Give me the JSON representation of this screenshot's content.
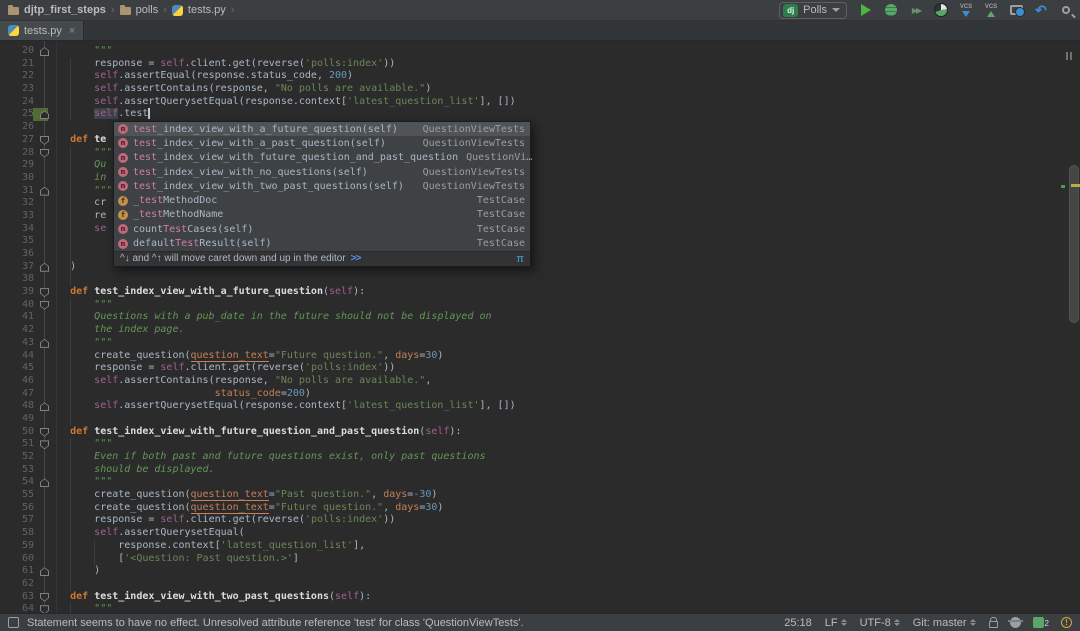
{
  "colors": {
    "editor_bg": "#2b2b2b",
    "bar_bg": "#3c3f41",
    "keyword": "#cc7832",
    "string": "#6a8759",
    "docstring": "#629755",
    "number": "#6897bb",
    "self": "#9e6191",
    "kwarg": "#c57f5a",
    "line_number": "#606366",
    "match": "#cd7fa7",
    "warn_stripe": "#b8ae3f",
    "vcs_added": "#526b34"
  },
  "breadcrumbs": {
    "project": "djtp_first_steps",
    "folder": "polls",
    "file": "tests.py",
    "separator": "›"
  },
  "toolbar": {
    "run_config": {
      "badge": "dj",
      "label": "Polls"
    },
    "icons": [
      {
        "name": "run-icon"
      },
      {
        "name": "debug-icon"
      },
      {
        "name": "coverage-icon",
        "glyph": "▶▶"
      },
      {
        "name": "concurrency-diagram-icon"
      },
      {
        "name": "vcs-update-icon",
        "text": "VCS"
      },
      {
        "name": "vcs-commit-icon",
        "text": "VCS"
      },
      {
        "name": "local-history-icon"
      },
      {
        "name": "rollback-icon",
        "glyph": "↶"
      },
      {
        "name": "search-everywhere-icon"
      }
    ]
  },
  "tab": {
    "title": "tests.py",
    "close_label": "×"
  },
  "editor": {
    "lines": [
      {
        "n": 20,
        "i": 8,
        "fold": "up",
        "segs": [
          [
            "d",
            "\"\"\""
          ]
        ]
      },
      {
        "n": 21,
        "i": 8,
        "segs": [
          [
            "p",
            "response = "
          ],
          [
            "sf",
            "self"
          ],
          [
            "p",
            ".client.get(reverse("
          ],
          [
            "s",
            "'polls:index'"
          ],
          [
            "p",
            "))"
          ]
        ]
      },
      {
        "n": 22,
        "i": 8,
        "segs": [
          [
            "sf",
            "self"
          ],
          [
            "p",
            ".assertEqual(response.status_code, "
          ],
          [
            "n",
            "200"
          ],
          [
            "p",
            ")"
          ]
        ]
      },
      {
        "n": 23,
        "i": 8,
        "segs": [
          [
            "sf",
            "self"
          ],
          [
            "p",
            ".assertContains(response, "
          ],
          [
            "s",
            "\"No polls are available.\""
          ],
          [
            "p",
            ")"
          ]
        ]
      },
      {
        "n": 24,
        "i": 8,
        "segs": [
          [
            "sf",
            "self"
          ],
          [
            "p",
            ".assertQuerysetEqual(response.context["
          ],
          [
            "s",
            "'latest_question_list'"
          ],
          [
            "p",
            "], [])"
          ]
        ]
      },
      {
        "n": 25,
        "i": 8,
        "fold": "up",
        "vcs": true,
        "caret": true,
        "segs": [
          [
            "hl-sf",
            "self"
          ],
          [
            "p",
            ".test"
          ]
        ]
      },
      {
        "n": 26,
        "i": 0,
        "segs": []
      },
      {
        "n": 27,
        "i": 4,
        "fold": "down",
        "segs": [
          [
            "k",
            "def "
          ],
          [
            "fn",
            "te"
          ]
        ]
      },
      {
        "n": 28,
        "i": 8,
        "fold": "down",
        "segs": [
          [
            "d",
            "\"\"\""
          ]
        ]
      },
      {
        "n": 29,
        "i": 8,
        "segs": [
          [
            "di",
            "Qu"
          ]
        ]
      },
      {
        "n": 30,
        "i": 8,
        "segs": [
          [
            "di",
            "in"
          ]
        ]
      },
      {
        "n": 31,
        "i": 8,
        "fold": "up",
        "segs": [
          [
            "d",
            "\"\"\""
          ]
        ]
      },
      {
        "n": 32,
        "i": 8,
        "segs": [
          [
            "p",
            "cr"
          ]
        ]
      },
      {
        "n": 33,
        "i": 8,
        "segs": [
          [
            "p",
            "re"
          ]
        ]
      },
      {
        "n": 34,
        "i": 8,
        "segs": [
          [
            "sf",
            "se"
          ]
        ]
      },
      {
        "n": 35,
        "i": 0,
        "segs": []
      },
      {
        "n": 36,
        "i": 0,
        "segs": []
      },
      {
        "n": 37,
        "i": 4,
        "fold": "up",
        "segs": [
          [
            "p",
            ")"
          ]
        ]
      },
      {
        "n": 38,
        "i": 0,
        "segs": []
      },
      {
        "n": 39,
        "i": 4,
        "fold": "down",
        "segs": [
          [
            "k",
            "def "
          ],
          [
            "fn",
            "test_index_view_with_a_future_question"
          ],
          [
            "p",
            "("
          ],
          [
            "sf",
            "self"
          ],
          [
            "p",
            "):"
          ]
        ]
      },
      {
        "n": 40,
        "i": 8,
        "fold": "down",
        "segs": [
          [
            "d",
            "\"\"\""
          ]
        ]
      },
      {
        "n": 41,
        "i": 8,
        "segs": [
          [
            "di",
            "Questions with a pub_date in the future should not be displayed on"
          ]
        ]
      },
      {
        "n": 42,
        "i": 8,
        "segs": [
          [
            "di",
            "the index page."
          ]
        ]
      },
      {
        "n": 43,
        "i": 8,
        "fold": "up",
        "segs": [
          [
            "d",
            "\"\"\""
          ]
        ]
      },
      {
        "n": 44,
        "i": 8,
        "segs": [
          [
            "p",
            "create_question("
          ],
          [
            "kwu",
            "question_text"
          ],
          [
            "p",
            "="
          ],
          [
            "s",
            "\"Future question.\""
          ],
          [
            "p",
            ", "
          ],
          [
            "kw",
            "days"
          ],
          [
            "p",
            "="
          ],
          [
            "n",
            "30"
          ],
          [
            "p",
            ")"
          ]
        ]
      },
      {
        "n": 45,
        "i": 8,
        "segs": [
          [
            "p",
            "response = "
          ],
          [
            "sf",
            "self"
          ],
          [
            "p",
            ".client.get(reverse("
          ],
          [
            "s",
            "'polls:index'"
          ],
          [
            "p",
            "))"
          ]
        ]
      },
      {
        "n": 46,
        "i": 8,
        "segs": [
          [
            "sf",
            "self"
          ],
          [
            "p",
            ".assertContains(response, "
          ],
          [
            "s",
            "\"No polls are available.\""
          ],
          [
            "p",
            ","
          ]
        ]
      },
      {
        "n": 47,
        "i": 28,
        "segs": [
          [
            "kw",
            "status_code"
          ],
          [
            "p",
            "="
          ],
          [
            "n",
            "200"
          ],
          [
            "p",
            ")"
          ]
        ]
      },
      {
        "n": 48,
        "i": 8,
        "fold": "up",
        "segs": [
          [
            "sf",
            "self"
          ],
          [
            "p",
            ".assertQuerysetEqual(response.context["
          ],
          [
            "s",
            "'latest_question_list'"
          ],
          [
            "p",
            "], [])"
          ]
        ]
      },
      {
        "n": 49,
        "i": 0,
        "segs": []
      },
      {
        "n": 50,
        "i": 4,
        "fold": "down",
        "segs": [
          [
            "k",
            "def "
          ],
          [
            "fn",
            "test_index_view_with_future_question_and_past_question"
          ],
          [
            "p",
            "("
          ],
          [
            "sf",
            "self"
          ],
          [
            "p",
            "):"
          ]
        ]
      },
      {
        "n": 51,
        "i": 8,
        "fold": "down",
        "segs": [
          [
            "d",
            "\"\"\""
          ]
        ]
      },
      {
        "n": 52,
        "i": 8,
        "segs": [
          [
            "di",
            "Even if both past and future questions exist, only past questions"
          ]
        ]
      },
      {
        "n": 53,
        "i": 8,
        "segs": [
          [
            "di",
            "should be displayed."
          ]
        ]
      },
      {
        "n": 54,
        "i": 8,
        "fold": "up",
        "segs": [
          [
            "d",
            "\"\"\""
          ]
        ]
      },
      {
        "n": 55,
        "i": 8,
        "segs": [
          [
            "p",
            "create_question("
          ],
          [
            "kwu",
            "question_text"
          ],
          [
            "p",
            "="
          ],
          [
            "s",
            "\"Past question.\""
          ],
          [
            "p",
            ", "
          ],
          [
            "kw",
            "days"
          ],
          [
            "p",
            "="
          ],
          [
            "n",
            "-30"
          ],
          [
            "p",
            ")"
          ]
        ]
      },
      {
        "n": 56,
        "i": 8,
        "segs": [
          [
            "p",
            "create_question("
          ],
          [
            "kwu",
            "question_text"
          ],
          [
            "p",
            "="
          ],
          [
            "s",
            "\"Future question.\""
          ],
          [
            "p",
            ", "
          ],
          [
            "kw",
            "days"
          ],
          [
            "p",
            "="
          ],
          [
            "n",
            "30"
          ],
          [
            "p",
            ")"
          ]
        ]
      },
      {
        "n": 57,
        "i": 8,
        "segs": [
          [
            "p",
            "response = "
          ],
          [
            "sf",
            "self"
          ],
          [
            "p",
            ".client.get(reverse("
          ],
          [
            "s",
            "'polls:index'"
          ],
          [
            "p",
            "))"
          ]
        ]
      },
      {
        "n": 58,
        "i": 8,
        "segs": [
          [
            "sf",
            "self"
          ],
          [
            "p",
            ".assertQuerysetEqual("
          ]
        ]
      },
      {
        "n": 59,
        "i": 12,
        "segs": [
          [
            "p",
            "response.context["
          ],
          [
            "s",
            "'latest_question_list'"
          ],
          [
            "p",
            "],"
          ]
        ]
      },
      {
        "n": 60,
        "i": 12,
        "segs": [
          [
            "p",
            "["
          ],
          [
            "s",
            "'<Question: Past question.>'"
          ],
          [
            "p",
            "]"
          ]
        ]
      },
      {
        "n": 61,
        "i": 8,
        "fold": "up",
        "segs": [
          [
            "p",
            ")"
          ]
        ]
      },
      {
        "n": 62,
        "i": 0,
        "segs": []
      },
      {
        "n": 63,
        "i": 4,
        "fold": "down",
        "segs": [
          [
            "k",
            "def "
          ],
          [
            "fn",
            "test_index_view_with_two_past_questions"
          ],
          [
            "p",
            "("
          ],
          [
            "sf",
            "self"
          ],
          [
            "p",
            "):"
          ]
        ]
      },
      {
        "n": 64,
        "i": 8,
        "fold": "down",
        "segs": [
          [
            "d",
            "\"\"\""
          ]
        ]
      }
    ]
  },
  "popup": {
    "items": [
      {
        "icon": "m",
        "parts": [
          [
            "mm",
            "test"
          ],
          [
            "t",
            "_index_view_with_a_future_question(self)"
          ]
        ],
        "right": "QuestionViewTests",
        "selected": true
      },
      {
        "icon": "m",
        "parts": [
          [
            "mm",
            "test"
          ],
          [
            "t",
            "_index_view_with_a_past_question(self)"
          ]
        ],
        "right": "QuestionViewTests"
      },
      {
        "icon": "m",
        "parts": [
          [
            "mm",
            "test"
          ],
          [
            "t",
            "_index_view_with_future_question_and_past_question"
          ]
        ],
        "right": "QuestionVi…"
      },
      {
        "icon": "m",
        "parts": [
          [
            "mm",
            "test"
          ],
          [
            "t",
            "_index_view_with_no_questions(self)"
          ]
        ],
        "right": "QuestionViewTests"
      },
      {
        "icon": "m",
        "parts": [
          [
            "mm",
            "test"
          ],
          [
            "t",
            "_index_view_with_two_past_questions(self)"
          ]
        ],
        "right": "QuestionViewTests"
      },
      {
        "icon": "f",
        "parts": [
          [
            "t",
            "_"
          ],
          [
            "mm",
            "test"
          ],
          [
            "t",
            "MethodDoc"
          ]
        ],
        "right": "TestCase"
      },
      {
        "icon": "f",
        "parts": [
          [
            "t",
            "_"
          ],
          [
            "mm",
            "test"
          ],
          [
            "t",
            "MethodName"
          ]
        ],
        "right": "TestCase"
      },
      {
        "icon": "m",
        "parts": [
          [
            "t",
            "count"
          ],
          [
            "mm",
            "Test"
          ],
          [
            "t",
            "Cases(self)"
          ]
        ],
        "right": "TestCase"
      },
      {
        "icon": "m",
        "parts": [
          [
            "t",
            "default"
          ],
          [
            "mm",
            "Test"
          ],
          [
            "t",
            "Result(self)"
          ]
        ],
        "right": "TestCase"
      }
    ],
    "hint": "^↓ and ^↑ will move caret down and up in the editor",
    "hint_link": ">>",
    "hint_symbol": "π"
  },
  "status_bar": {
    "message": "Statement seems to have no effect. Unresolved attribute reference 'test' for class 'QuestionViewTests'.",
    "caret_position": "25:18",
    "line_ending": "LF",
    "encoding": "UTF-8",
    "vcs_branch": "Git: master",
    "icons": [
      {
        "name": "lock-icon"
      },
      {
        "name": "inspections-profile-icon"
      },
      {
        "name": "notifications-icon",
        "count": "2"
      },
      {
        "name": "event-alert-icon",
        "glyph": "!"
      }
    ]
  }
}
